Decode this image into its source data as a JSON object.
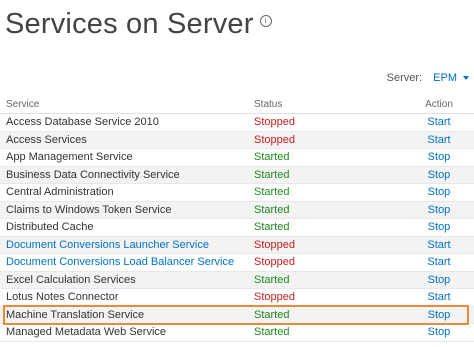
{
  "page": {
    "title": "Services on Server",
    "info_icon": "info-icon"
  },
  "server": {
    "label": "Server:",
    "value": "EPM"
  },
  "table": {
    "headers": {
      "service": "Service",
      "status": "Status",
      "action": "Action"
    },
    "rows": [
      {
        "service": "Access Database Service 2010",
        "status": "Stopped",
        "action": "Start",
        "link": false
      },
      {
        "service": "Access Services",
        "status": "Stopped",
        "action": "Start",
        "link": false
      },
      {
        "service": "App Management Service",
        "status": "Started",
        "action": "Stop",
        "link": false
      },
      {
        "service": "Business Data Connectivity Service",
        "status": "Started",
        "action": "Stop",
        "link": false
      },
      {
        "service": "Central Administration",
        "status": "Started",
        "action": "Stop",
        "link": false
      },
      {
        "service": "Claims to Windows Token Service",
        "status": "Started",
        "action": "Stop",
        "link": false
      },
      {
        "service": "Distributed Cache",
        "status": "Started",
        "action": "Stop",
        "link": false
      },
      {
        "service": "Document Conversions Launcher Service",
        "status": "Stopped",
        "action": "Start",
        "link": true
      },
      {
        "service": "Document Conversions Load Balancer Service",
        "status": "Stopped",
        "action": "Start",
        "link": true
      },
      {
        "service": "Excel Calculation Services",
        "status": "Started",
        "action": "Stop",
        "link": false
      },
      {
        "service": "Lotus Notes Connector",
        "status": "Stopped",
        "action": "Start",
        "link": false
      },
      {
        "service": "Machine Translation Service",
        "status": "Started",
        "action": "Stop",
        "link": false,
        "highlighted": true
      },
      {
        "service": "Managed Metadata Web Service",
        "status": "Started",
        "action": "Stop",
        "link": false
      }
    ]
  },
  "colors": {
    "started": "#1e8a1e",
    "stopped": "#c81d1d",
    "link": "#0072c6",
    "highlight": "#f0883a"
  }
}
